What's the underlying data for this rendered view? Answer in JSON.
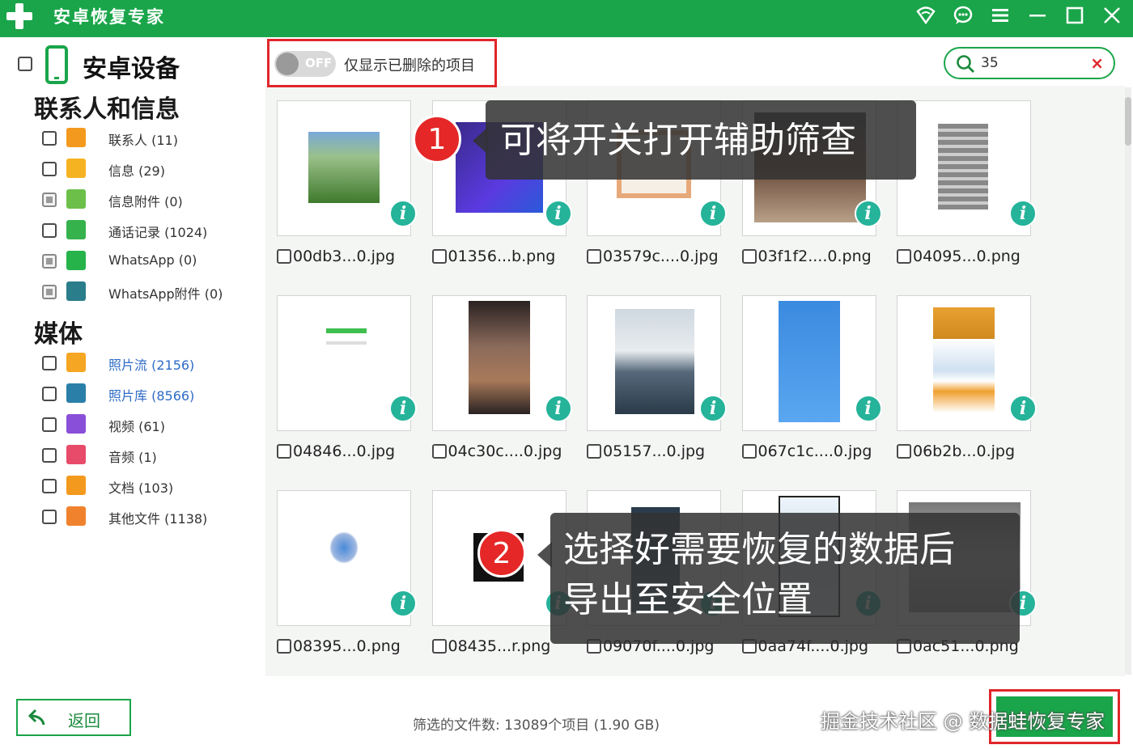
{
  "app": {
    "title": "安卓恢复专家",
    "brand_color": "#1aa54a"
  },
  "titlebar": {
    "icons": [
      "wifi-icon",
      "chat-icon",
      "menu-icon",
      "minimize-icon",
      "maximize-icon",
      "close-icon"
    ]
  },
  "sidebar": {
    "device_label": "安卓设备",
    "sections": [
      {
        "title": "联系人和信息",
        "items": [
          {
            "label": "联系人 (11)",
            "icon": "contacts-icon",
            "color": "#f39a1e"
          },
          {
            "label": "信息 (29)",
            "icon": "messages-icon",
            "color": "#f6b321"
          },
          {
            "label": "信息附件 (0)",
            "icon": "attachment-icon",
            "color": "#6cc04a"
          },
          {
            "label": "通话记录 (1024)",
            "icon": "phone-call-icon",
            "color": "#36b24d"
          },
          {
            "label": "WhatsApp (0)",
            "icon": "whatsapp-icon",
            "color": "#25b34a"
          },
          {
            "label": "WhatsApp附件 (0)",
            "icon": "whatsapp-attachment-icon",
            "color": "#2a7d8a"
          }
        ]
      },
      {
        "title": "媒体",
        "items": [
          {
            "label": "照片流 (2156)",
            "icon": "photostream-icon",
            "color": "#f5a623"
          },
          {
            "label": "照片库 (8566)",
            "icon": "photo-library-icon",
            "color": "#2a7fa8"
          },
          {
            "label": "视频 (61)",
            "icon": "video-icon",
            "color": "#8a4fd8"
          },
          {
            "label": "音频 (1)",
            "icon": "audio-icon",
            "color": "#e84a6a"
          },
          {
            "label": "文档 (103)",
            "icon": "document-icon",
            "color": "#f39a1e"
          },
          {
            "label": "其他文件 (1138)",
            "icon": "other-files-icon",
            "color": "#f0822e"
          }
        ]
      }
    ]
  },
  "filter": {
    "toggle_state": "OFF",
    "label": "仅显示已删除的项目"
  },
  "search": {
    "value": "35",
    "clear": "×"
  },
  "files": [
    {
      "name": "00db3...0.jpg"
    },
    {
      "name": "01356...b.png"
    },
    {
      "name": "03579c....0.jpg"
    },
    {
      "name": "03f1f2....0.png"
    },
    {
      "name": "04095...0.png"
    },
    {
      "name": "04846...0.jpg"
    },
    {
      "name": "04c30c....0.jpg"
    },
    {
      "name": "05157...0.jpg"
    },
    {
      "name": "067c1c....0.jpg"
    },
    {
      "name": "06b2b...0.jpg"
    },
    {
      "name": "08395...0.png"
    },
    {
      "name": "08435...r.png"
    },
    {
      "name": "09070f....0.jpg"
    },
    {
      "name": "0aa74f....0.jpg"
    },
    {
      "name": "0ac51...0.png"
    }
  ],
  "callouts": [
    {
      "number": "1",
      "text": "可将开关打开辅助筛查"
    },
    {
      "number": "2",
      "line1": "选择好需要恢复的数据后",
      "line2": "导出至安全位置"
    }
  ],
  "bottom": {
    "back_label": "返回",
    "stats": "筛选的文件数: 13089个项目 (1.90 GB)",
    "watermark": "掘金技术社区 @ 数据蛙恢复专家"
  }
}
